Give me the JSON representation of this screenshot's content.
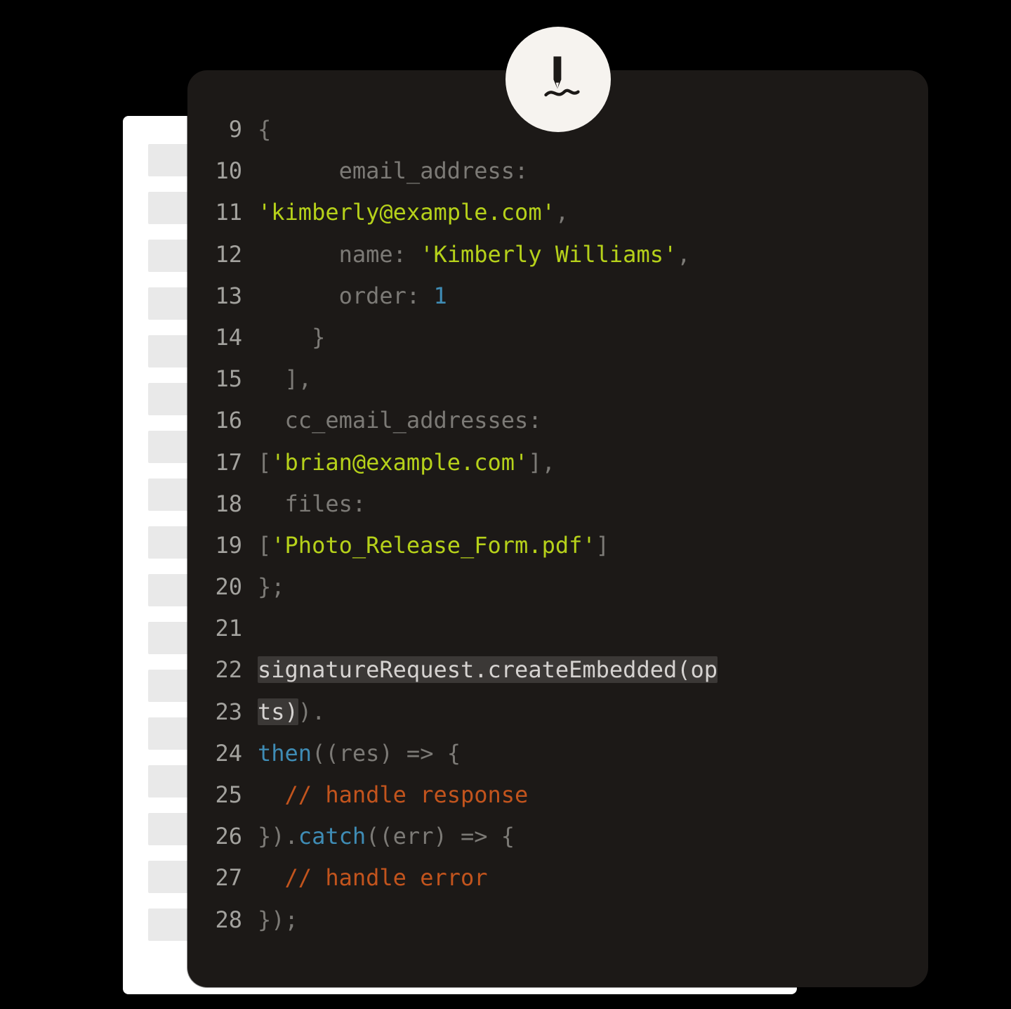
{
  "gutter_start": 9,
  "lines": [
    {
      "n": "9",
      "tokens": [
        {
          "c": "tok-plain",
          "t": "{"
        }
      ]
    },
    {
      "n": "10",
      "tokens": [
        {
          "c": "tok-plain",
          "t": "      email_address:"
        }
      ]
    },
    {
      "n": "11",
      "tokens": [
        {
          "c": "tok-string",
          "t": "'kimberly@example.com'"
        },
        {
          "c": "tok-plain",
          "t": ","
        }
      ]
    },
    {
      "n": "12",
      "tokens": [
        {
          "c": "tok-plain",
          "t": "      name: "
        },
        {
          "c": "tok-string",
          "t": "'Kimberly Williams'"
        },
        {
          "c": "tok-plain",
          "t": ","
        }
      ]
    },
    {
      "n": "13",
      "tokens": [
        {
          "c": "tok-plain",
          "t": "      order: "
        },
        {
          "c": "tok-number",
          "t": "1"
        }
      ]
    },
    {
      "n": "14",
      "tokens": [
        {
          "c": "tok-plain",
          "t": "    }"
        }
      ]
    },
    {
      "n": "15",
      "tokens": [
        {
          "c": "tok-plain",
          "t": "  ],"
        }
      ]
    },
    {
      "n": "16",
      "tokens": [
        {
          "c": "tok-plain",
          "t": "  cc_email_addresses:"
        }
      ]
    },
    {
      "n": "17",
      "tokens": [
        {
          "c": "tok-plain",
          "t": "["
        },
        {
          "c": "tok-string",
          "t": "'brian@example.com'"
        },
        {
          "c": "tok-plain",
          "t": "],"
        }
      ]
    },
    {
      "n": "18",
      "tokens": [
        {
          "c": "tok-plain",
          "t": "  files:"
        }
      ]
    },
    {
      "n": "19",
      "tokens": [
        {
          "c": "tok-plain",
          "t": "["
        },
        {
          "c": "tok-string",
          "t": "'Photo_Release_Form.pdf'"
        },
        {
          "c": "tok-plain",
          "t": "]"
        }
      ]
    },
    {
      "n": "20",
      "tokens": [
        {
          "c": "tok-plain",
          "t": "};"
        }
      ]
    },
    {
      "n": "21",
      "tokens": [
        {
          "c": "tok-plain",
          "t": " "
        }
      ]
    },
    {
      "n": "22",
      "tokens": [
        {
          "c": "tok-text",
          "hl": true,
          "t": "signatureRequest.createEmbedded(op"
        }
      ]
    },
    {
      "n": "23",
      "tokens": [
        {
          "c": "tok-text",
          "hl": true,
          "t": "ts)"
        },
        {
          "c": "tok-plain",
          "t": ")."
        }
      ]
    },
    {
      "n": "24",
      "tokens": [
        {
          "c": "tok-key",
          "t": "then"
        },
        {
          "c": "tok-plain",
          "t": "((res) => {"
        }
      ]
    },
    {
      "n": "25",
      "tokens": [
        {
          "c": "tok-comment",
          "t": "  // handle response"
        }
      ]
    },
    {
      "n": "26",
      "tokens": [
        {
          "c": "tok-plain",
          "t": "})."
        },
        {
          "c": "tok-key",
          "t": "catch"
        },
        {
          "c": "tok-plain",
          "t": "((err) => {"
        }
      ]
    },
    {
      "n": "27",
      "tokens": [
        {
          "c": "tok-comment",
          "t": "  // handle error"
        }
      ]
    },
    {
      "n": "28",
      "tokens": [
        {
          "c": "tok-plain",
          "t": "});"
        }
      ]
    }
  ],
  "bg_placeholders": [
    "short",
    "long",
    "long",
    "med",
    "long",
    "short",
    "long",
    "long",
    "med",
    "long",
    "short",
    "long",
    "long",
    "med",
    "long",
    "short",
    "long"
  ]
}
